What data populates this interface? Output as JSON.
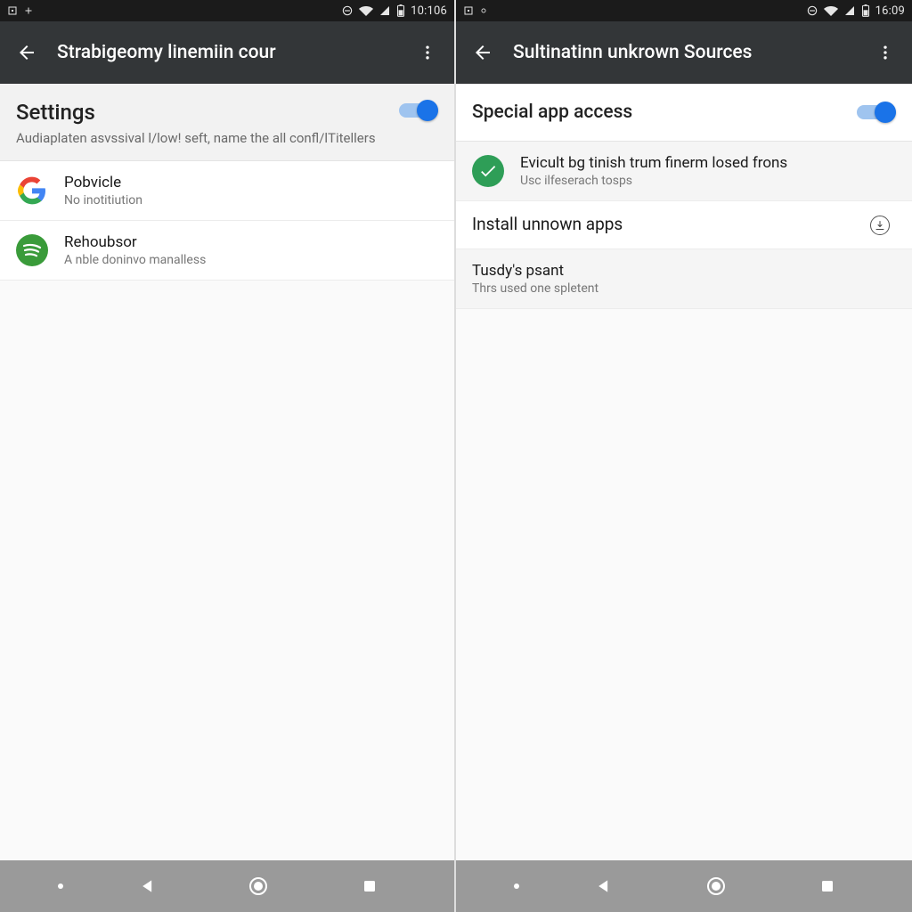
{
  "left": {
    "status": {
      "time": "10:106"
    },
    "appbar": {
      "title": "Strabigeomy linemiin cour"
    },
    "header": {
      "title": "Settings",
      "subtitle": "Audiaplaten asvssival l/low! seft, name the all confl/lTitellers"
    },
    "items": [
      {
        "icon": "google",
        "title": "Pobvicle",
        "sub": "No inotitiution"
      },
      {
        "icon": "spotify",
        "title": "Rehoubsor",
        "sub": "A nble doninvo manalless"
      }
    ]
  },
  "right": {
    "status": {
      "time": "16:09"
    },
    "appbar": {
      "title": "Sultinatinn unkrown Sources"
    },
    "header": {
      "title": "Special app access"
    },
    "row_checked": {
      "title": "Evicult bg tinish trum finerm losed frons",
      "sub": "Usc ilfeserach tosps"
    },
    "row_install": {
      "title": "Install unnown apps"
    },
    "row_tusdy": {
      "title": "Tusdy's psant",
      "sub": "Thrs used one spletent"
    }
  }
}
